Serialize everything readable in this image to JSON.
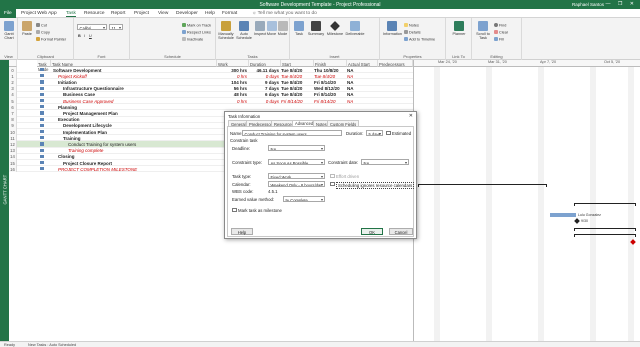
{
  "window": {
    "title": "Software Development Template - Project Professional",
    "user": "Raphael Santos",
    "controls": "— ❐ ✕"
  },
  "menu": {
    "tabs": [
      "File",
      "Project Web App",
      "Task",
      "Resource",
      "Report",
      "Project",
      "View",
      "Developer",
      "Help",
      "Format"
    ],
    "tell_me": "Tell me what you want to do"
  },
  "ribbon": {
    "groups": [
      "View",
      "Clipboard",
      "Font",
      "Schedule",
      "Tasks",
      "Insert",
      "Properties",
      "Insert",
      "Editing"
    ],
    "gantt_chart": "Gantt Chart",
    "paste": "Paste",
    "cut": "Cut",
    "copy": "Copy",
    "format_painter": "Format Painter",
    "font_name": "Calibri",
    "font_size": "11",
    "mark_on_track": "Mark on Track",
    "respect_links": "Respect Links",
    "inactivate": "Inactivate",
    "manually_schedule": "Manually Schedule",
    "auto_schedule": "Auto Schedule",
    "inspect": "Inspect",
    "move": "Move",
    "mode": "Mode",
    "task": "Task",
    "summary": "Summary",
    "milestone": "Milestone",
    "deliverable": "Deliverable",
    "information": "Information",
    "notes": "Notes",
    "details": "Details",
    "add_to_timeline": "Add to Timeline",
    "planner": "Planner",
    "scroll_to_task": "Scroll to Task",
    "find": "Find",
    "clear": "Clear",
    "fill": "Fill",
    "link_to": "Link To"
  },
  "sidebar_label": "GANTT CHART",
  "columns": [
    "Task Mode",
    "Task Name",
    "Work",
    "Duration",
    "Start",
    "Finish",
    "Actual Start",
    "Predecessors"
  ],
  "tasks": [
    {
      "id": "0",
      "name": "Software Development",
      "work": "300 hrs",
      "duration": "46.11 days",
      "start": "Tue 8/4/20",
      "finish": "Thu 10/8/20",
      "actual": "NA",
      "style": "bold",
      "indent": 0
    },
    {
      "id": "1",
      "name": "Project Kickoff",
      "work": "0 hrs",
      "duration": "0 days",
      "start": "Tue 8/4/20",
      "finish": "Tue 8/4/20",
      "actual": "NA",
      "style": "red",
      "indent": 1
    },
    {
      "id": "2",
      "name": "Initiation",
      "work": "104 hrs",
      "duration": "9 days",
      "start": "Tue 8/4/20",
      "finish": "Fri 8/14/20",
      "actual": "NA",
      "style": "bold",
      "indent": 1
    },
    {
      "id": "3",
      "name": "Infrastructure Questionnaire",
      "work": "56 hrs",
      "duration": "7 days",
      "start": "Tue 8/4/20",
      "finish": "Wed 8/12/20",
      "actual": "NA",
      "style": "bold",
      "indent": 2
    },
    {
      "id": "4",
      "name": "Business Case",
      "work": "48 hrs",
      "duration": "6 days",
      "start": "Tue 8/4/20",
      "finish": "Fri 8/14/20",
      "actual": "NA",
      "style": "bold",
      "indent": 2
    },
    {
      "id": "5",
      "name": "Business Case Approved",
      "work": "0 hrs",
      "duration": "0 days",
      "start": "Fri 8/14/20",
      "finish": "Fri 8/14/20",
      "actual": "NA",
      "style": "red",
      "indent": 2
    },
    {
      "id": "6",
      "name": "Planning",
      "work": "",
      "duration": "",
      "start": "",
      "finish": "",
      "actual": "",
      "style": "bold",
      "indent": 1
    },
    {
      "id": "7",
      "name": "Project Management Plan",
      "work": "",
      "duration": "",
      "start": "",
      "finish": "",
      "actual": "",
      "style": "bold",
      "indent": 2
    },
    {
      "id": "8",
      "name": "Execution",
      "work": "",
      "duration": "",
      "start": "",
      "finish": "",
      "actual": "",
      "style": "bold",
      "indent": 1
    },
    {
      "id": "9",
      "name": "Development Lifecycle",
      "work": "",
      "duration": "",
      "start": "",
      "finish": "",
      "actual": "",
      "style": "bold",
      "indent": 2
    },
    {
      "id": "10",
      "name": "Implementation Plan",
      "work": "",
      "duration": "",
      "start": "",
      "finish": "",
      "actual": "",
      "style": "bold",
      "indent": 2
    },
    {
      "id": "11",
      "name": "Training",
      "work": "",
      "duration": "",
      "start": "",
      "finish": "",
      "actual": "",
      "style": "bold",
      "indent": 2
    },
    {
      "id": "12",
      "name": "Conduct Training for system users",
      "work": "",
      "duration": "",
      "start": "",
      "finish": "",
      "actual": "",
      "style": "normal",
      "indent": 3,
      "selected": true
    },
    {
      "id": "13",
      "name": "Training complete",
      "work": "",
      "duration": "",
      "start": "",
      "finish": "",
      "actual": "",
      "style": "red",
      "indent": 3
    },
    {
      "id": "14",
      "name": "Closing",
      "work": "",
      "duration": "",
      "start": "",
      "finish": "",
      "actual": "",
      "style": "bold",
      "indent": 1
    },
    {
      "id": "15",
      "name": "Project Closure Report",
      "work": "",
      "duration": "",
      "start": "",
      "finish": "",
      "actual": "",
      "style": "bold",
      "indent": 2
    },
    {
      "id": "16",
      "name": "PROJECT COMPLETION MILESTONE",
      "work": "",
      "duration": "",
      "start": "",
      "finish": "",
      "actual": "",
      "style": "red",
      "indent": 1
    }
  ],
  "gantt": {
    "weeks": [
      "Mar 24, '20",
      "Mar 31, '20",
      "Apr 7, '20",
      "Oct 5, '20"
    ],
    "bar_label_resource": "Lulu Gonzalez",
    "bar_label_date": "9/30"
  },
  "dialog": {
    "title": "Task Information",
    "close": "✕",
    "tabs": [
      "General",
      "Predecessors",
      "Resources",
      "Advanced",
      "Notes",
      "Custom Fields"
    ],
    "active_tab": "Advanced",
    "name_label": "Name:",
    "name_value": "Conduct Training for system users",
    "duration_label": "Duration:",
    "duration_value": "5 days",
    "estimated_label": "Estimated",
    "constrain_task_label": "Constrain task",
    "deadline_label": "Deadline:",
    "deadline_value": "NA",
    "constraint_type_label": "Constraint type:",
    "constraint_type_value": "As Soon As Possible",
    "constraint_date_label": "Constraint date:",
    "constraint_date_value": "NA",
    "task_type_label": "Task type:",
    "task_type_value": "Fixed Work",
    "effort_driven_label": "Effort driven",
    "calendar_label": "Calendar:",
    "calendar_value": "Weekend Only - 8 hours/day",
    "scheduling_ignores_label": "Scheduling ignores resource calendars",
    "wbs_label": "WBS code:",
    "wbs_value": "4.5.1",
    "earned_value_label": "Earned value method:",
    "earned_value_value": "% Complete",
    "mark_milestone_label": "Mark task as milestone",
    "help": "Help",
    "ok": "OK",
    "cancel": "Cancel"
  },
  "status": {
    "ready": "Ready",
    "new_tasks": "New Tasks : Auto Scheduled"
  },
  "colors": {
    "brand": "#227447",
    "bar": "#7da2cf",
    "selected_row": "#d8e8d2",
    "critical_text": "#cc0000"
  }
}
